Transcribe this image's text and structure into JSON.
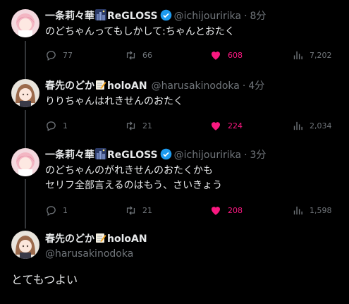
{
  "tweets": [
    {
      "name": "一条莉々華",
      "name_suffix": "ReGLOSS",
      "handle": "@ichijouririka",
      "time": "8分",
      "text": "のどちゃんってもしかして:ちゃんとおたく",
      "replies": "77",
      "retweets": "66",
      "likes": "608",
      "views": "7,202"
    },
    {
      "name": "春先のどか",
      "name_suffix": "holoAN",
      "handle": "@harusakinodoka",
      "time": "4分",
      "text": "りりちゃんはれきせんのおたく",
      "replies": "1",
      "retweets": "21",
      "likes": "224",
      "views": "2,034"
    },
    {
      "name": "一条莉々華",
      "name_suffix": "ReGLOSS",
      "handle": "@ichijouririka",
      "time": "3分",
      "text_line1": "のどちゃんのがれきせんのおたくかも",
      "text_line2": "セリフ全部言えるのはもう、さいきょう",
      "replies": "1",
      "retweets": "21",
      "likes": "208",
      "views": "1,598"
    }
  ],
  "main_tweet": {
    "name": "春先のどか",
    "name_suffix": "holoAN",
    "handle": "@harusakinodoka",
    "text": "とてもつよい"
  },
  "separator": "·",
  "colors": {
    "background": "#000000",
    "text": "#e7e9ea",
    "muted": "#71767b",
    "like": "#f91880",
    "verified": "#1d9bf0",
    "thread_line": "#333639"
  },
  "icons": [
    "reply-icon",
    "retweet-icon",
    "heart-icon",
    "views-icon",
    "verified-icon",
    "night-city-emoji",
    "pencil-memo-emoji"
  ]
}
